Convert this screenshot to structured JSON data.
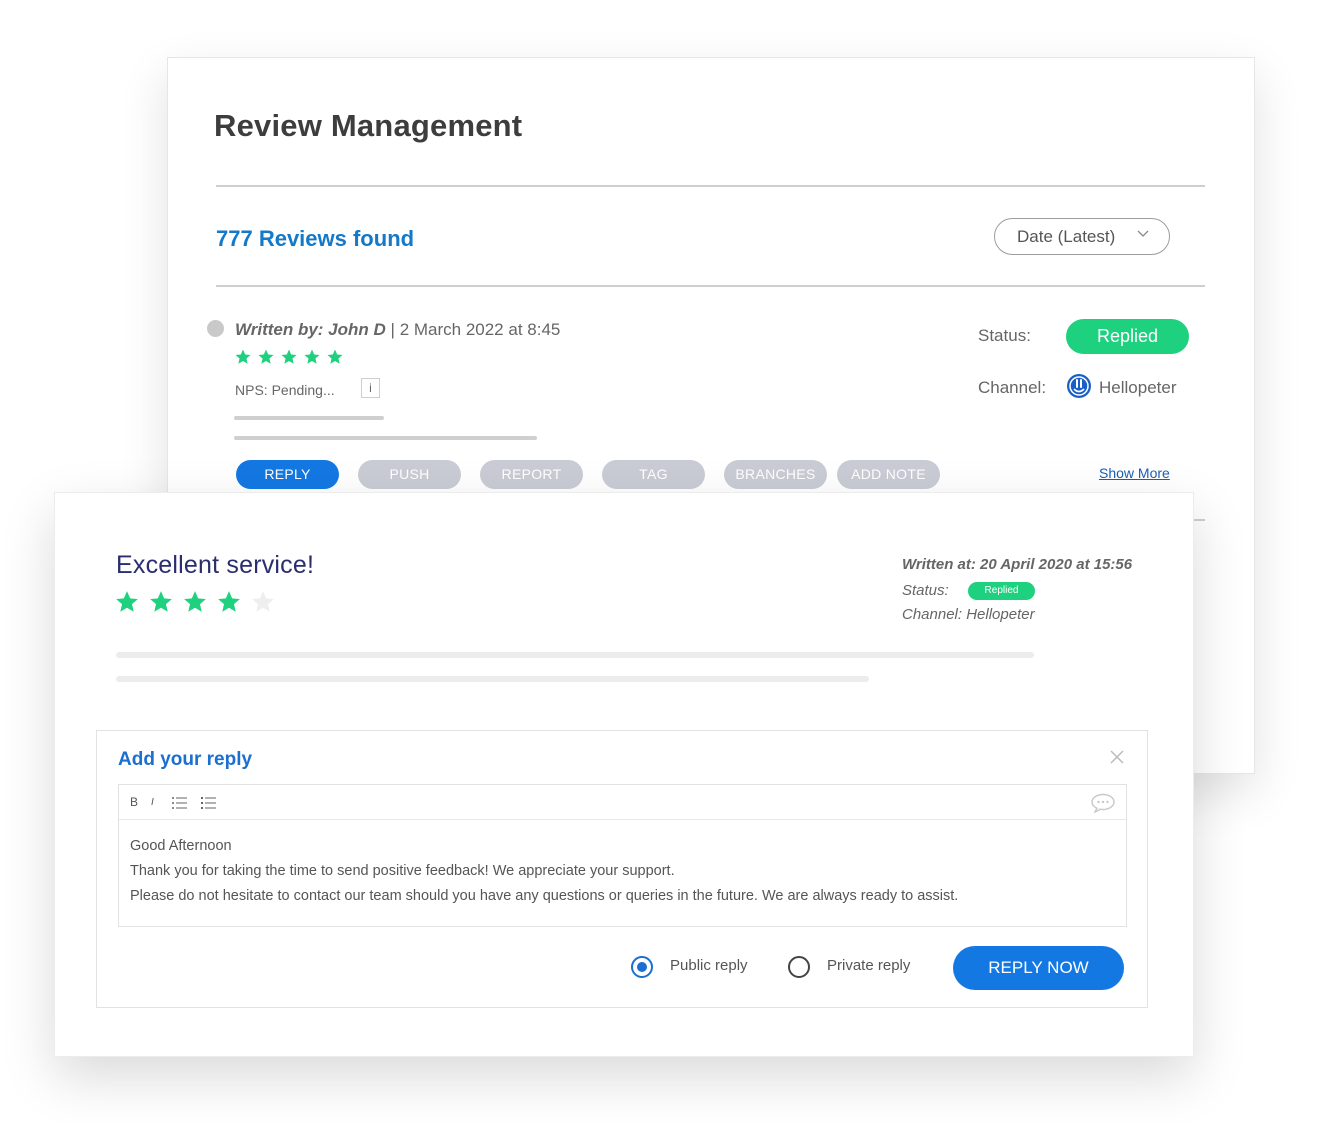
{
  "back_card": {
    "title": "Review Management",
    "reviews_found": "777 Reviews found",
    "sort": {
      "selected": "Date (Latest)"
    },
    "review": {
      "written_by": "Written by: John D",
      "separator": "|",
      "date": "2 March 2022 at 8:45",
      "rating": 5,
      "nps": "NPS: Pending...",
      "info": "i",
      "status_label": "Status:",
      "status": "Replied",
      "channel_label": "Channel:",
      "channel": "Hellopeter"
    },
    "actions": [
      "REPLY",
      "PUSH",
      "REPORT",
      "TAG",
      "BRANCHES",
      "ADD NOTE"
    ],
    "show_more": "Show More"
  },
  "front_card": {
    "title": "Excellent service!",
    "rating": 4,
    "rating_max": 5,
    "written_at": "Written at: 20 April 2020 at 15:56",
    "status_label": "Status:",
    "status": "Replied",
    "channel": "Channel: Hellopeter",
    "reply": {
      "title": "Add your reply",
      "toolbar": {
        "bold": "B",
        "italic": "I"
      },
      "lines": [
        "Good Afternoon",
        "Thank you for taking the time to send positive feedback! We appreciate your support.",
        "Please do not hesitate to contact our team should you have any questions or queries in the future. We are always ready to assist."
      ],
      "public_label": "Public reply",
      "private_label": "Private reply",
      "visibility": "public",
      "submit": "REPLY NOW"
    }
  },
  "colors": {
    "primary": "#1478e3",
    "success": "#1ed17f",
    "link": "#1479c8",
    "title_navy": "#2a2d6e",
    "muted_button": "#c9ccd4"
  },
  "icons": [
    "chevron-down-icon",
    "star-icon",
    "info-icon",
    "hellopeter-icon",
    "close-icon",
    "bulleted-list-icon",
    "numbered-list-icon",
    "comment-icon"
  ]
}
